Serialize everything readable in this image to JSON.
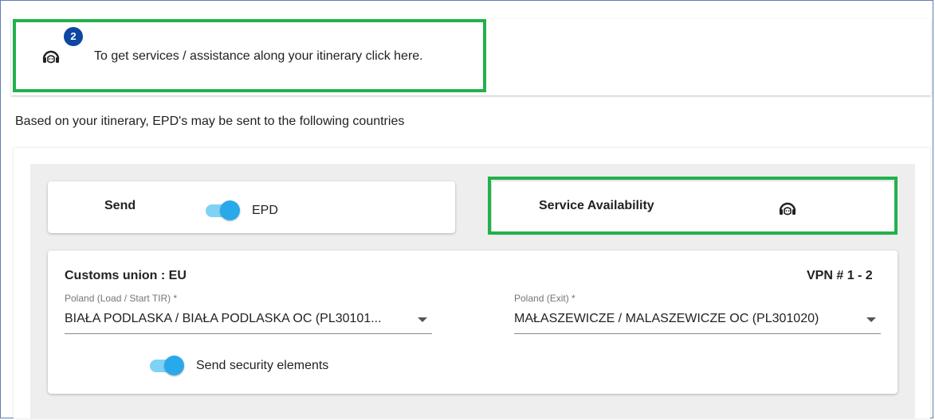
{
  "banner": {
    "badge_count": "2",
    "text": "To get services / assistance along your itinerary click here.",
    "icon": "headset-icon"
  },
  "info_text": "Based on your itinerary, EPD's may be sent to the following countries",
  "send_card": {
    "send_label": "Send",
    "epd_label": "EPD",
    "epd_toggle_on": true
  },
  "service_card": {
    "label": "Service Availability",
    "icon": "headset-icon"
  },
  "details": {
    "customs_union": "Customs union : EU",
    "vpn": "VPN # 1 - 2",
    "load_label": "Poland (Load / Start TIR) *",
    "load_value": "BIAŁA PODLASKA / BIAŁA PODLASKA OC (PL30101...",
    "exit_label": "Poland (Exit) *",
    "exit_value": "MAŁASZEWICZE / MALASZEWICZE OC (PL301020)",
    "security_label": "Send security elements",
    "security_toggle_on": true
  },
  "colors": {
    "highlight": "#22b14c",
    "badge": "#0d47a1",
    "toggle_track": "#7fd2f6",
    "toggle_knob": "#29a9ea"
  }
}
